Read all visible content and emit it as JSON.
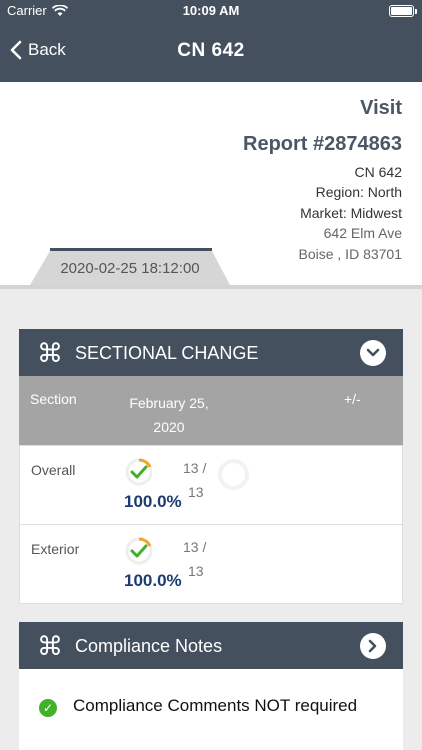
{
  "status_bar": {
    "carrier": "Carrier",
    "time": "10:09 AM"
  },
  "nav": {
    "back_label": "Back",
    "title": "CN 642"
  },
  "report": {
    "visit": "Visit",
    "report_number": "Report #2874863",
    "store": "CN 642",
    "region": "Region: North",
    "market": "Market: Midwest",
    "address1": "642 Elm Ave",
    "address2": "Boise , ID 83701",
    "datetime": "2020-02-25 18:12:00"
  },
  "sectional": {
    "title": "SECTIONAL CHANGE",
    "columns": {
      "section": "Section",
      "date": "February 25, 2020",
      "diff": "+/-"
    },
    "rows": [
      {
        "label": "Overall",
        "percent": "100.0%",
        "count_top": "13 /",
        "count_bottom": "13"
      },
      {
        "label": "Exterior",
        "percent": "100.0%",
        "count_top": "13 /",
        "count_bottom": "13"
      }
    ]
  },
  "notes": {
    "title": "Compliance Notes",
    "items": [
      {
        "text": "Compliance Comments NOT required"
      }
    ]
  },
  "colors": {
    "navbar": "#45505f",
    "accent_text": "#1b3b73",
    "check_green": "#43b02a",
    "ring_orange": "#f0a42a"
  }
}
